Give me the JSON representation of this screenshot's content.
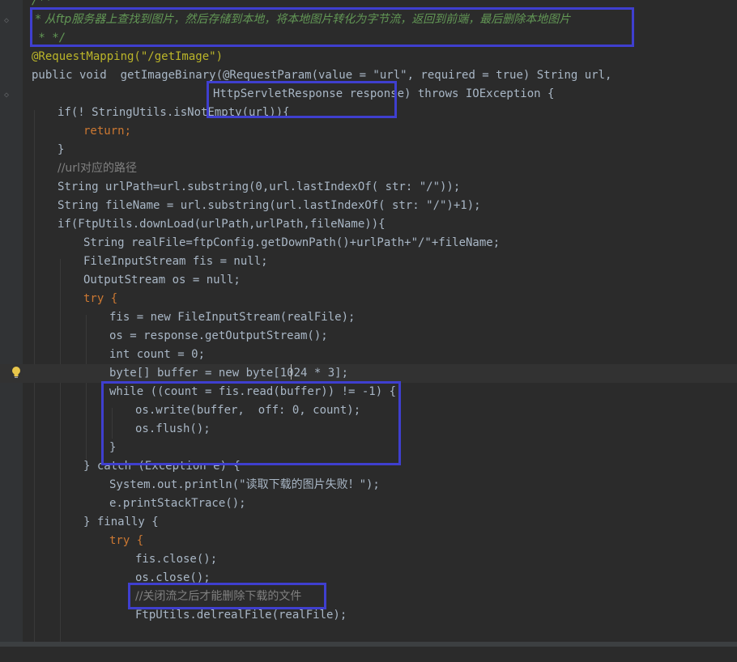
{
  "editor": {
    "language": "Java",
    "colors": {
      "background": "#2b2b2b",
      "keyword": "#cc7832",
      "annotation": "#bbb529",
      "string": "#6a8759",
      "number": "#6897bb",
      "field": "#9876aa",
      "comment": "#808080",
      "doc_comment": "#629755",
      "highlight_box": "#3f3fcf"
    },
    "icons": [
      "lightbulb-icon",
      "fold-marker-icon"
    ],
    "lines": {
      "l0": "/**",
      "l1": " * 从ftp服务器上查找到图片，然后存储到本地，将本地图片转化为字节流，返回到前端，最后删除本地图片",
      "l2": " * */",
      "l3": "@RequestMapping(\"/getImage\")",
      "l4": "public void  getImageBinary(@RequestParam(value = \"url\", required = true) String url,",
      "l5": "HttpServletResponse response) throws IOException {",
      "l6": "if(! StringUtils.isNotEmpty(url)){",
      "l7": "return;",
      "l8": "}",
      "l9": "//url对应的路径",
      "l10": "String urlPath=url.substring(0,url.lastIndexOf( str: \"/\"));",
      "l11": "String fileName = url.substring(url.lastIndexOf( str: \"/\")+1);",
      "l12": "if(FtpUtils.downLoad(urlPath,urlPath,fileName)){",
      "l13": "String realFile=ftpConfig.getDownPath()+urlPath+\"/\"+fileName;",
      "l14": "FileInputStream fis = null;",
      "l15": "OutputStream os = null;",
      "l16": "try {",
      "l17": "fis = new FileInputStream(realFile);",
      "l18": "os = response.getOutputStream();",
      "l19": "int count = 0;",
      "l20": "byte[] buffer = new byte[1024 * 3];",
      "l21": "while ((count = fis.read(buffer)) != -1) {",
      "l22": "os.write(buffer,  off: 0, count);",
      "l23": "os.flush();",
      "l24": "}",
      "l25": "} catch (Exception e) {",
      "l26": "System.out.println(\"读取下载的图片失败！\");",
      "l27": "e.printStackTrace();",
      "l28": "} finally {",
      "l29": "try {",
      "l30": "fis.close();",
      "l31": "os.close();",
      "l32": "//关闭流之后才能删除下载的文件",
      "l33": "FtpUtils.delrealFile(realFile);"
    }
  }
}
